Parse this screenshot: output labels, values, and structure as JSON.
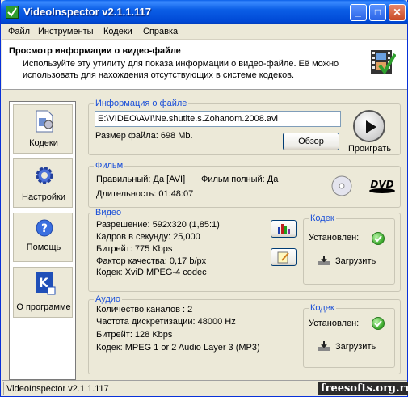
{
  "window": {
    "title": "VideoInspector v2.1.1.117"
  },
  "menu": [
    "Файл",
    "Инструменты",
    "Кодеки",
    "Справка"
  ],
  "header": {
    "title": "Просмотр информации о видео-файле",
    "description": "Используйте эту утилиту для показа информации о видео-файле. Её можно использовать для нахождения отсутствующих в системе кодеков."
  },
  "sidebar": [
    {
      "label": "Кодеки",
      "icon": "codecs-icon"
    },
    {
      "label": "Настройки",
      "icon": "settings-icon"
    },
    {
      "label": "Помощь",
      "icon": "help-icon"
    },
    {
      "label": "О программе",
      "icon": "about-icon"
    }
  ],
  "file_info": {
    "title": "Информация о файле",
    "path": "E:\\VIDEO\\AVI\\Ne.shutite.s.Zohanom.2008.avi",
    "size": "Размер файла: 698 Mb.",
    "browse_label": "Обзор",
    "play_label": "Проиграть"
  },
  "film": {
    "title": "Фильм",
    "valid": "Правильный: Да [AVI]",
    "complete": "Фильм полный: Да",
    "duration": "Длительность: 01:48:07"
  },
  "video": {
    "title": "Видео",
    "lines": [
      "Разрешение: 592x320 (1,85:1)",
      "Кадров в секунду: 25,000",
      "Битрейт: 775 Kbps",
      "Фактор качества: 0,17 b/px",
      "Кодек: XviD MPEG-4 codec"
    ],
    "codec": {
      "title": "Кодек",
      "installed": "Установлен:",
      "download": "Загрузить"
    }
  },
  "audio": {
    "title": "Аудио",
    "lines": [
      "Количество каналов : 2",
      "Частота дискретизации: 48000 Hz",
      "Битрейт: 128 Kbps",
      "Кодек: MPEG 1 or 2 Audio Layer 3 (MP3)"
    ],
    "codec": {
      "title": "Кодек",
      "installed": "Установлен:",
      "download": "Загрузить"
    }
  },
  "status": {
    "text": "VideoInspector v2.1.1.117",
    "watermark": "freesofts.org.ru"
  },
  "colors": {
    "group_title": "#1a4fd8",
    "titlebar": "#0b5ee6",
    "ok": "#3aa82a"
  }
}
